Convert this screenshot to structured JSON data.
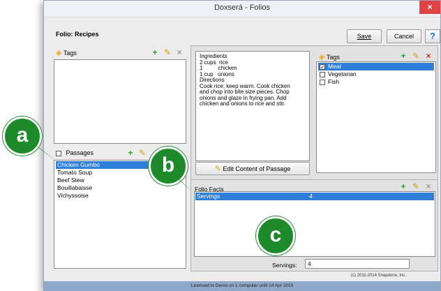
{
  "window": {
    "title": "Doxserá - Folios",
    "close_glyph": "×"
  },
  "header": {
    "folio_label": "Folio:  Recipes",
    "save_label": "Save",
    "cancel_label": "Cancel",
    "help_label": "?"
  },
  "left_tags": {
    "label": "Tags"
  },
  "passages": {
    "label": "Passages",
    "items": [
      "Chicken Gumbo",
      "Tomato Soup",
      "Beef Stew",
      "Bouillabaisse",
      "Vichyssoise"
    ],
    "selected_index": 0
  },
  "content": {
    "lines": [
      "Ingredients",
      "2 cups  rice",
      "1          chicken",
      "1 cup   onions",
      "Directions",
      "Cook rice; keep warm. Cook chicken",
      "and chop into bite size pieces.  Chop",
      "onions and glaze in frying pan.  Add",
      "chicken and onions to rice and stir."
    ],
    "edit_button_label": "Edit Content of Passage"
  },
  "right_tags": {
    "label": "Tags",
    "items": [
      {
        "label": "Meat",
        "checked": true,
        "selected": true
      },
      {
        "label": "Vegetarian",
        "checked": false,
        "selected": false
      },
      {
        "label": "Fish",
        "checked": false,
        "selected": false
      }
    ]
  },
  "folio_facts": {
    "label": "Folio Facts",
    "rows": [
      {
        "name": "Servings",
        "value": "4"
      }
    ],
    "servings_label": "Servings:",
    "servings_value": "4"
  },
  "copyright": "(c) 2011-2014 Snapdone, Inc.",
  "status": "Licensed to Demo on 1 computer until 14 Apr 2015",
  "callouts": {
    "a": "a",
    "b": "b",
    "c": "c"
  },
  "colors": {
    "selection": "#2f7fd8",
    "callout": "#1f8a2b",
    "close": "#e04343",
    "status_bar": "#8fa7c8"
  }
}
